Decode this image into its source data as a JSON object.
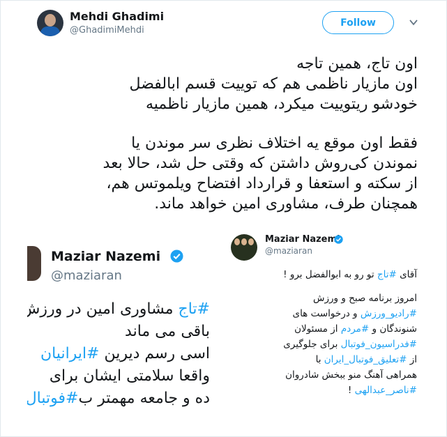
{
  "author": {
    "name": "Mehdi Ghadimi",
    "handle": "@GhadimiMehdi"
  },
  "follow_label": "Follow",
  "tweet": {
    "lines": [
      "اون تاج، همین تاجه",
      "اون مازیار ناظمی هم که توییت قسم ابالفضل",
      "خودشو ریتوییت میکرد، همین مازیار ناظمیه",
      "فقط اون موقع یه اختلاف نظری سر موندن یا",
      "نموندن کی‌روش داشتن که وقتی حل شد، حالا بعد",
      "از سکته و استعفا و قرارداد افتضاح ویلموتس هم،",
      "همچنان طرف، مشاوری امین خواهد ماند."
    ]
  },
  "embed_left": {
    "name": "Maziar Nazemi",
    "handle": "@maziaran",
    "lines": [
      {
        "tag": "#تاج",
        "text": " مشاوری امین در ورزش"
      },
      {
        "tag": "",
        "text": "باقی می ماند"
      },
      {
        "tag": "#ایرانیان",
        "text": "اسی رسم دیرین "
      },
      {
        "tag": "",
        "text": "واقعا سلامتی ایشان برای"
      },
      {
        "tag": "#فوتبال",
        "text": "ده و جامعه  مهمتر ب"
      }
    ]
  },
  "embed_right": {
    "name": "Maziar Nazemi",
    "handle": "@maziaran",
    "l1_pre": "آقای ",
    "l1_tag": "#تاج",
    "l1_post": " تو رو به ابوالفضل برو !",
    "p1": "امروز برنامه صبح و ورزش",
    "p2_tag": "#رادیو_ورزش",
    "p2": " و درخواست های",
    "p3": "شنوندگان و ",
    "p3_tag": "#مردم",
    "p3_post": " از  مسئولان",
    "p4_tag": "#فدراسیون_فوتبال",
    "p4": " برای جلوگیری",
    "p5": "از ",
    "p5_tag": "#تعلیق_فوتبال_ایران",
    "p5_post": " با",
    "p6": "همراهی آهنگ منو ببخش شادروان",
    "p7_tag": "#ناصر_عبدالهی",
    "p7": " !"
  },
  "colors": {
    "accent": "#1da1f2",
    "text": "#14171a",
    "muted": "#657786"
  },
  "icons": {
    "verified": "verified-badge-icon",
    "menu": "chevron-down-icon"
  }
}
